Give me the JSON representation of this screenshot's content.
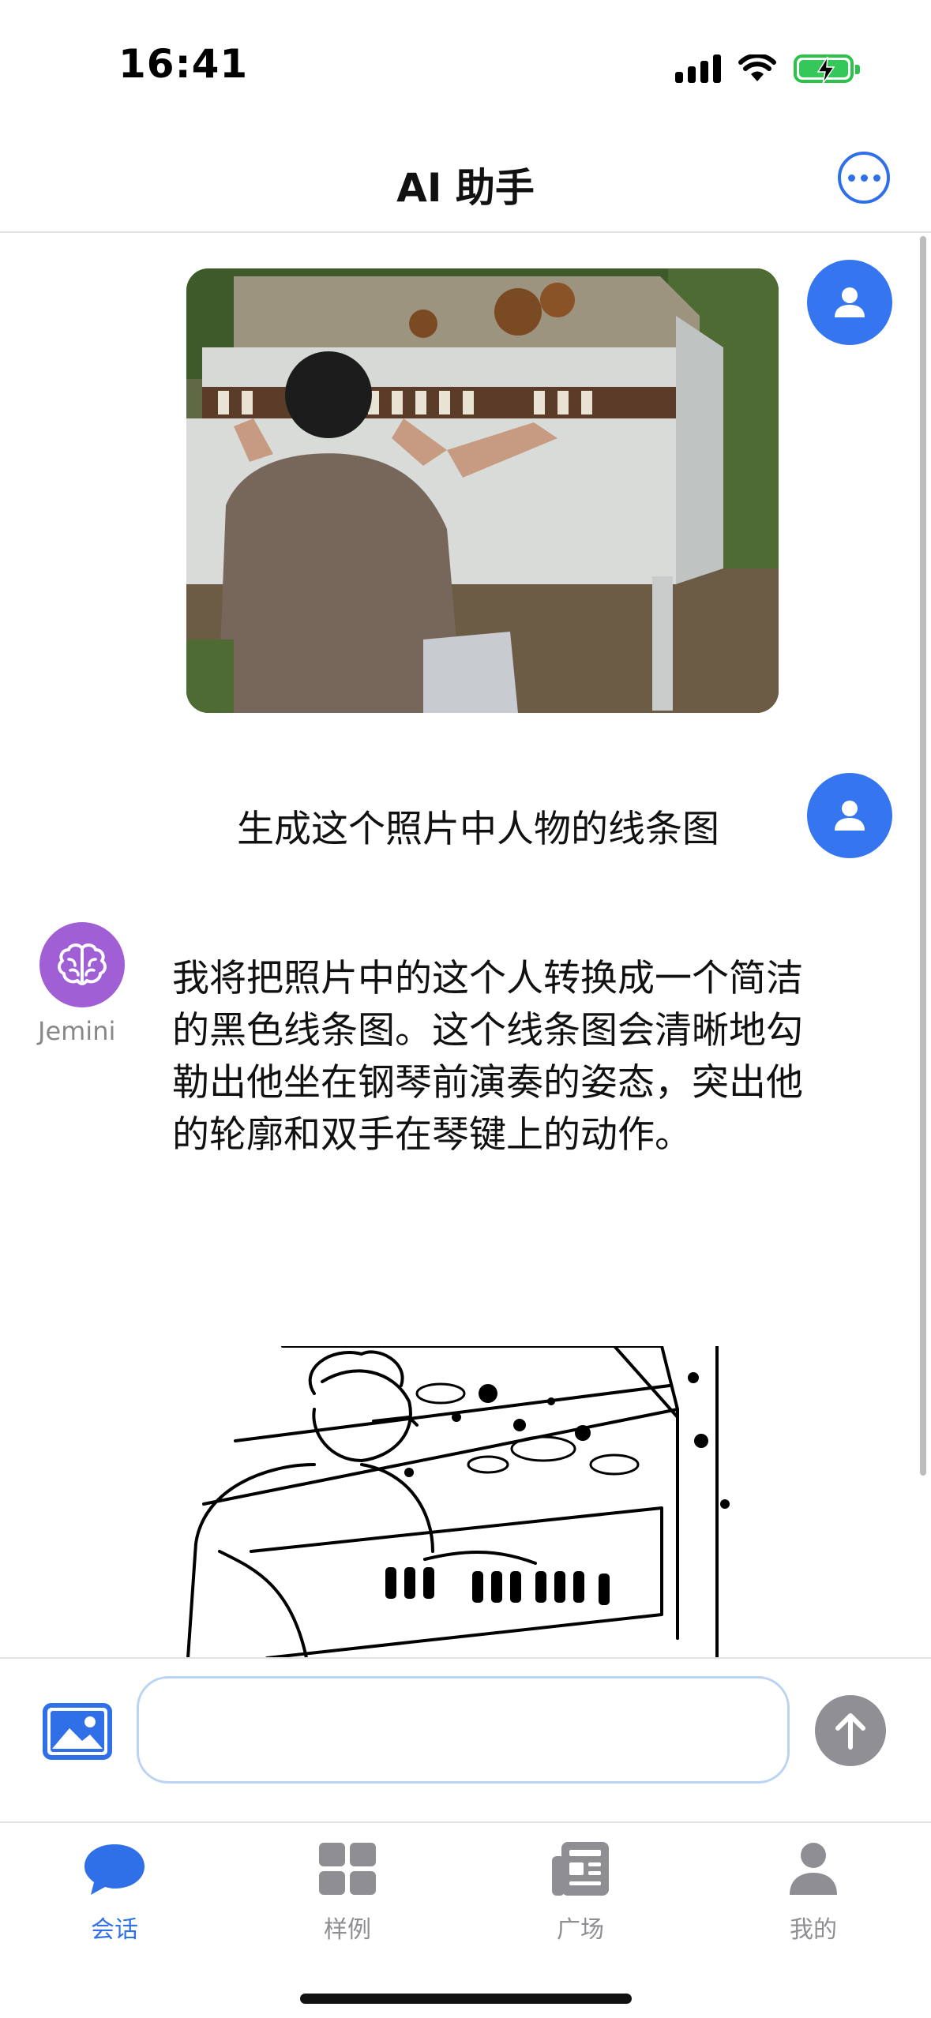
{
  "status_bar": {
    "time": "16:41"
  },
  "header": {
    "title": "AI 助手",
    "more_icon": "more-options-icon"
  },
  "chat": {
    "messages": [
      {
        "role": "user",
        "type": "image",
        "alt": ""
      },
      {
        "role": "user",
        "type": "text",
        "text": "生成这个照片中人物的线条图"
      },
      {
        "role": "assistant",
        "name": "Jemini",
        "type": "text",
        "text": "我将把照片中的这个人转换成一个简洁的黑色线条图。这个线条图会清晰地勾勒出他坐在钢琴前演奏的姿态，突出他的轮廓和双手在琴键上的动作。"
      },
      {
        "role": "assistant",
        "type": "image"
      }
    ]
  },
  "input": {
    "value": "",
    "placeholder": ""
  },
  "tabs": [
    {
      "label": "会话",
      "icon": "chat-bubble-icon",
      "active": true
    },
    {
      "label": "样例",
      "icon": "grid-icon",
      "active": false
    },
    {
      "label": "广场",
      "icon": "newspaper-icon",
      "active": false
    },
    {
      "label": "我的",
      "icon": "person-icon",
      "active": false
    }
  ],
  "colors": {
    "accent": "#2f6fe8",
    "user_avatar": "#3576f0",
    "ai_avatar": "#a05fd5",
    "send_disabled": "#8f8f94"
  }
}
